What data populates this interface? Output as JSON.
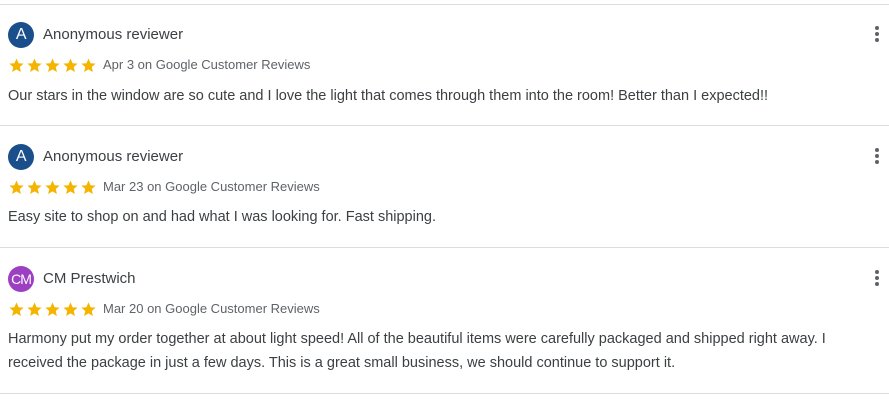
{
  "reviews": [
    {
      "avatar_initials": "A",
      "avatar_color": "#1a4f8b",
      "reviewer": "Anonymous reviewer",
      "rating": 5,
      "date_source": "Apr 3 on Google Customer Reviews",
      "text": "Our stars in the window are so cute and I love the light that comes through them into the room! Better than I expected!!"
    },
    {
      "avatar_initials": "A",
      "avatar_color": "#1a4f8b",
      "reviewer": "Anonymous reviewer",
      "rating": 5,
      "date_source": "Mar 23 on Google Customer Reviews",
      "text": "Easy site to shop on and had what I was looking for. Fast shipping."
    },
    {
      "avatar_initials": "CM",
      "avatar_color": "#9c3fc2",
      "reviewer": "CM Prestwich",
      "rating": 5,
      "date_source": "Mar 20 on Google Customer Reviews",
      "text": "Harmony put my order together at about light speed! All of the beautiful items were carefully packaged and shipped right away. I received the package in just a few days. This is a great small business, we should continue to support it."
    }
  ],
  "colors": {
    "star": "#f4b400",
    "divider": "#dadce0",
    "menu_icon": "#5f6368"
  },
  "icons": {
    "star": "star-icon",
    "more": "more-vert-icon"
  }
}
